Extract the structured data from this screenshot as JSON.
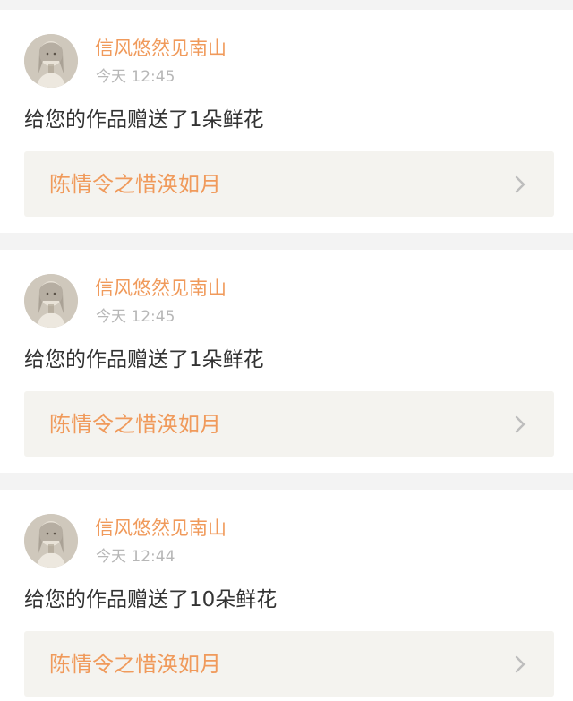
{
  "notifications": [
    {
      "username": "信风悠然见南山",
      "time": "今天 12:45",
      "message": "给您的作品赠送了1朵鲜花",
      "work_title": "陈情令之惜涣如月"
    },
    {
      "username": "信风悠然见南山",
      "time": "今天 12:45",
      "message": "给您的作品赠送了1朵鲜花",
      "work_title": "陈情令之惜涣如月"
    },
    {
      "username": "信风悠然见南山",
      "time": "今天 12:44",
      "message": "给您的作品赠送了10朵鲜花",
      "work_title": "陈情令之惜涣如月"
    }
  ],
  "colors": {
    "accent": "#f09a5b",
    "timestamp": "#b7b7b7",
    "text": "#333333",
    "link_bg": "#f4f3ef",
    "page_bg": "#f3f3f3"
  },
  "icons": {
    "avatar": "avatar-image",
    "chevron": "chevron-right-icon"
  }
}
